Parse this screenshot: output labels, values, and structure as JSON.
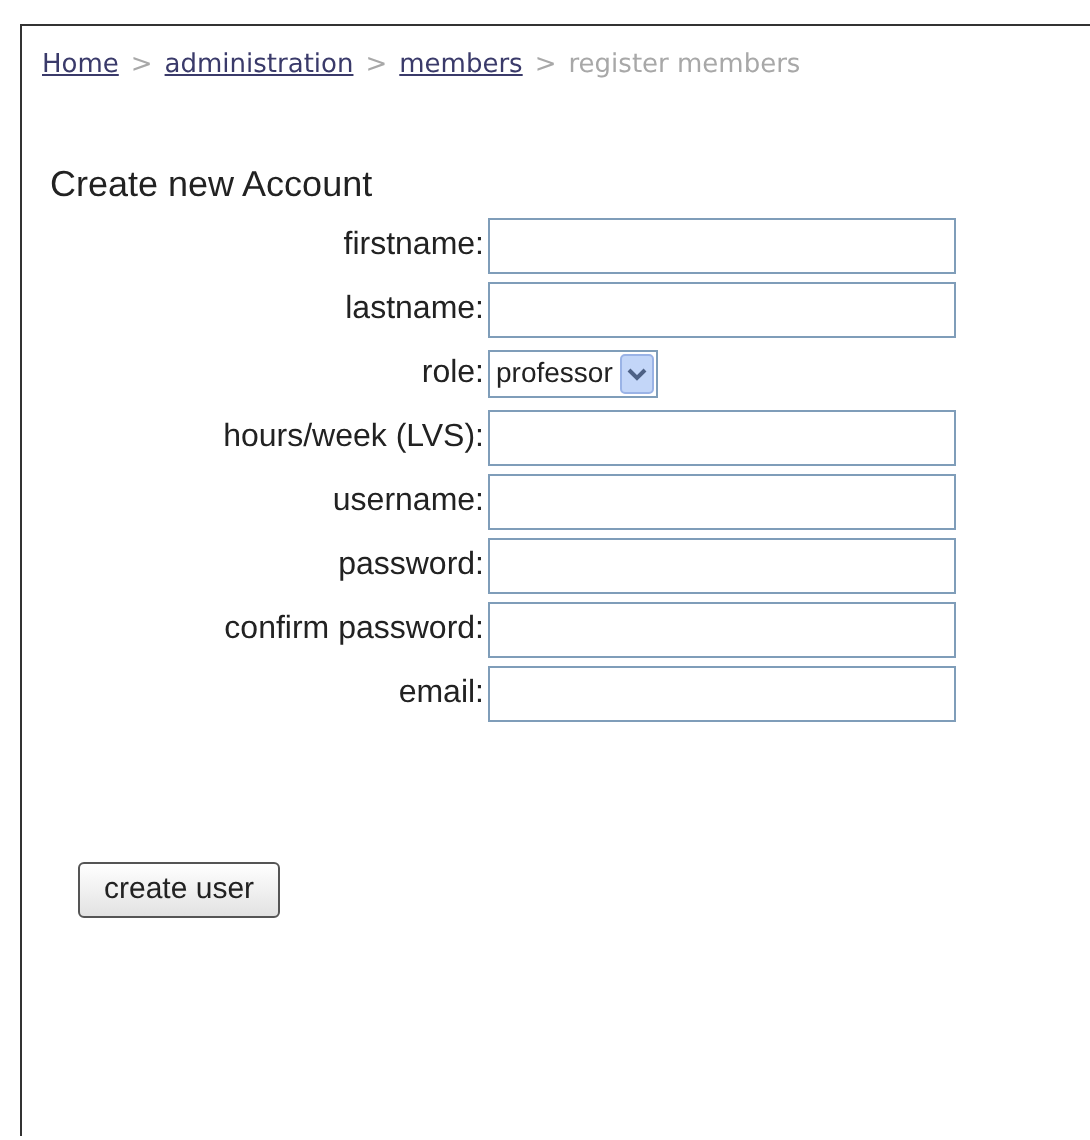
{
  "breadcrumb": [
    {
      "label": "Home",
      "kind": "link"
    },
    {
      "label": ">",
      "kind": "sep"
    },
    {
      "label": "administration",
      "kind": "link"
    },
    {
      "label": ">",
      "kind": "sep"
    },
    {
      "label": "members",
      "kind": "link"
    },
    {
      "label": ">",
      "kind": "sep"
    },
    {
      "label": "register members",
      "kind": "current"
    }
  ],
  "title": "Create new Account",
  "fields": [
    {
      "label": "firstname:",
      "kind": "text"
    },
    {
      "label": "lastname:",
      "kind": "text"
    },
    {
      "label": "role:",
      "kind": "select",
      "value": "professor"
    },
    {
      "label": "hours/week (LVS):",
      "kind": "text"
    },
    {
      "label": "username:",
      "kind": "text"
    },
    {
      "label": "password:",
      "kind": "password"
    },
    {
      "label": "confirm password:",
      "kind": "password"
    },
    {
      "label": "email:",
      "kind": "text"
    }
  ],
  "button": "create user"
}
